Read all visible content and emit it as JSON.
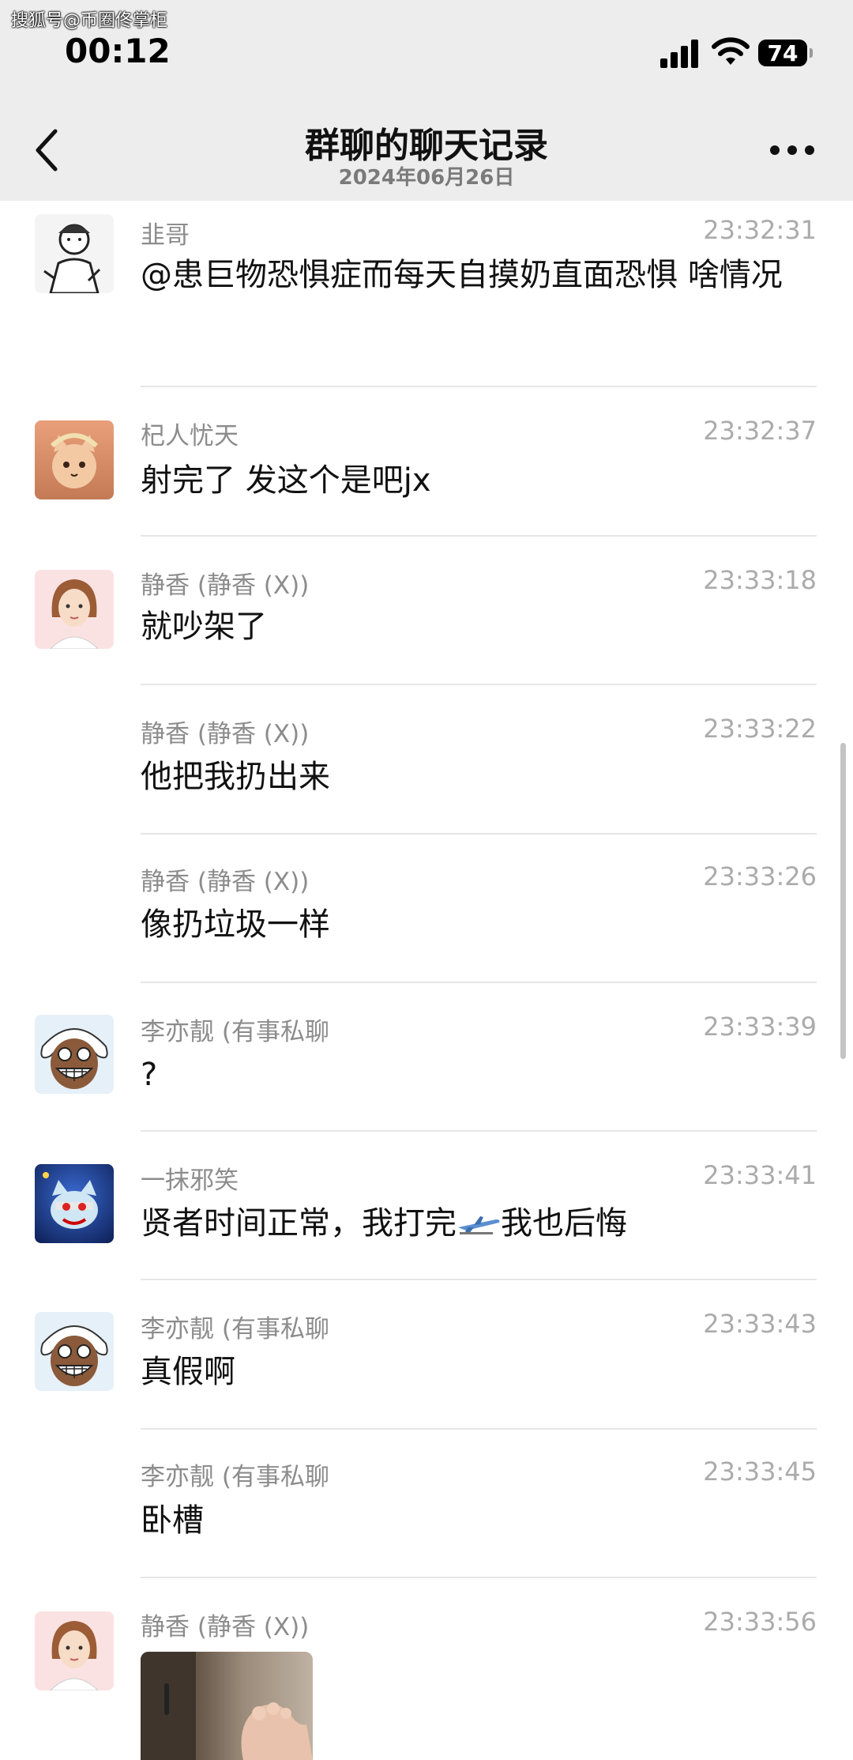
{
  "watermark": "搜狐号@币圈佟掌柜",
  "status_bar": {
    "time": "00:12",
    "battery": "74"
  },
  "header": {
    "title": "群聊的聊天记录",
    "subtitle": "2024年06月26日"
  },
  "messages": [
    {
      "sender": "韭哥",
      "time": "23:32:31",
      "text": "@患巨物恐惧症而每天自摸奶直面恐惧 啥情况",
      "avatar": "sketch-man-avatar"
    },
    {
      "sender": "杞人忧天",
      "time": "23:32:37",
      "text": "射完了 发这个是吧jx",
      "avatar": "orange-cat-avatar"
    },
    {
      "sender": "静香 (静香 (X))",
      "time": "23:33:18",
      "text": "就吵架了",
      "avatar": "girl-avatar"
    },
    {
      "sender": "静香 (静香 (X))",
      "time": "23:33:22",
      "text": "他把我扔出来",
      "avatar": ""
    },
    {
      "sender": "静香 (静香 (X))",
      "time": "23:33:26",
      "text": "像扔垃圾一样",
      "avatar": ""
    },
    {
      "sender": "李亦靓 (有事私聊",
      "time": "23:33:39",
      "text": "?",
      "avatar": "grinning-pirate-avatar"
    },
    {
      "sender": "一抹邪笑",
      "time": "23:33:41",
      "text_before": "贤者时间正常，我打完",
      "text_after": "我也后悔",
      "emoji": "airplane-icon",
      "avatar": "cartoon-dog-avatar"
    },
    {
      "sender": "李亦靓 (有事私聊",
      "time": "23:33:43",
      "text": "真假啊",
      "avatar": "grinning-pirate-avatar"
    },
    {
      "sender": "李亦靓 (有事私聊",
      "time": "23:33:45",
      "text": "卧槽",
      "avatar": ""
    },
    {
      "sender": "静香 (静香 (X))",
      "time": "23:33:56",
      "image": "photo-thumbnail",
      "avatar": "girl-avatar"
    }
  ]
}
